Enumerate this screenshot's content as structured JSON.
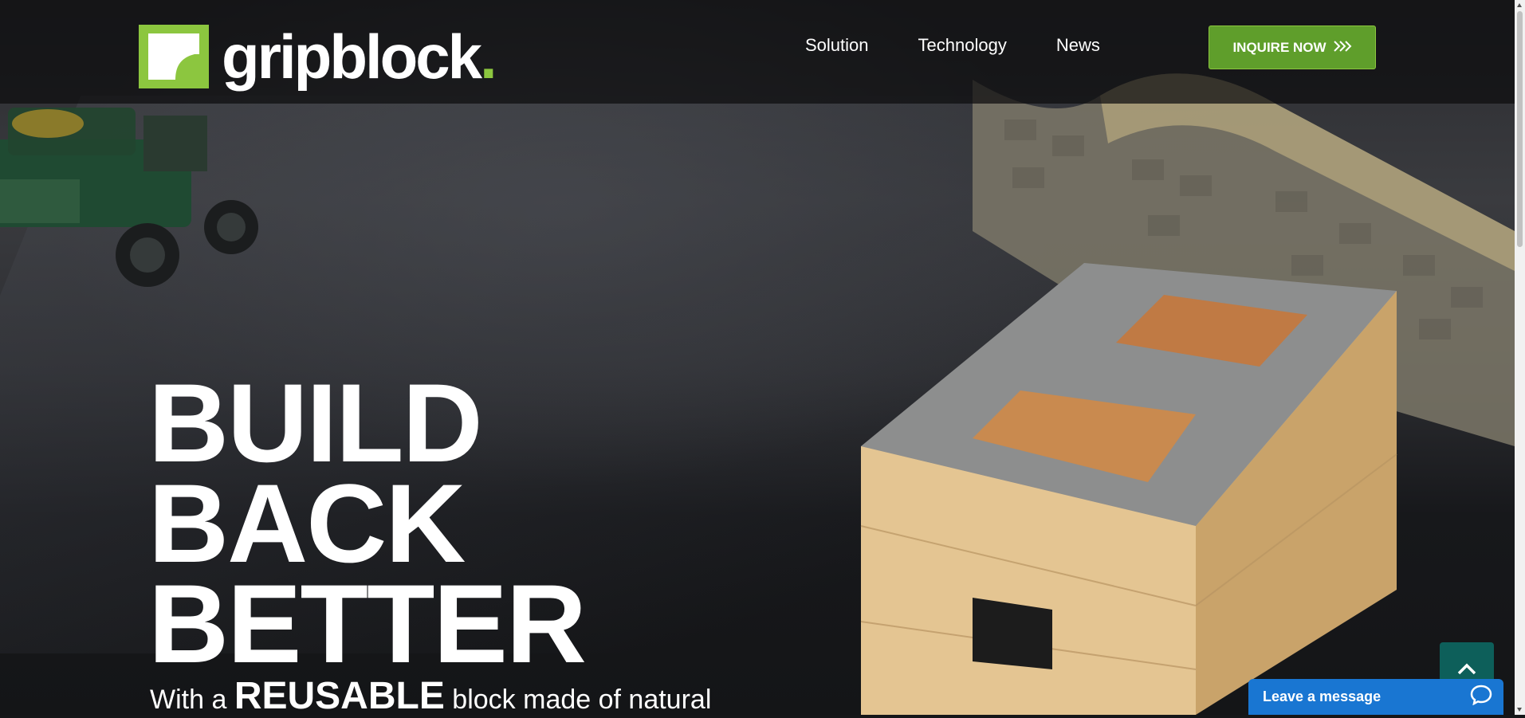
{
  "header": {
    "logo_text": "gripblock",
    "logo_dot": ".",
    "nav": [
      {
        "label": "Solution"
      },
      {
        "label": "Technology"
      },
      {
        "label": "News"
      }
    ],
    "cta_label": "INQUIRE NOW"
  },
  "hero": {
    "headline": [
      "BUILD",
      "BACK",
      "BETTER"
    ],
    "sub_prefix": "With a",
    "sub_emphasis": "REUSABLE",
    "sub_suffix": "block made of natural"
  },
  "widgets": {
    "chat_label": "Leave a message"
  },
  "colors": {
    "brand_green": "#8cc63f",
    "cta_green": "#5f9e2b",
    "chat_blue": "#1976d2",
    "scroll_top_teal": "#0d5f5a"
  },
  "icons": {
    "cta": "double-chevron-right-icon",
    "scroll_top": "chevron-up-icon",
    "chat": "chat-bubble-icon"
  }
}
